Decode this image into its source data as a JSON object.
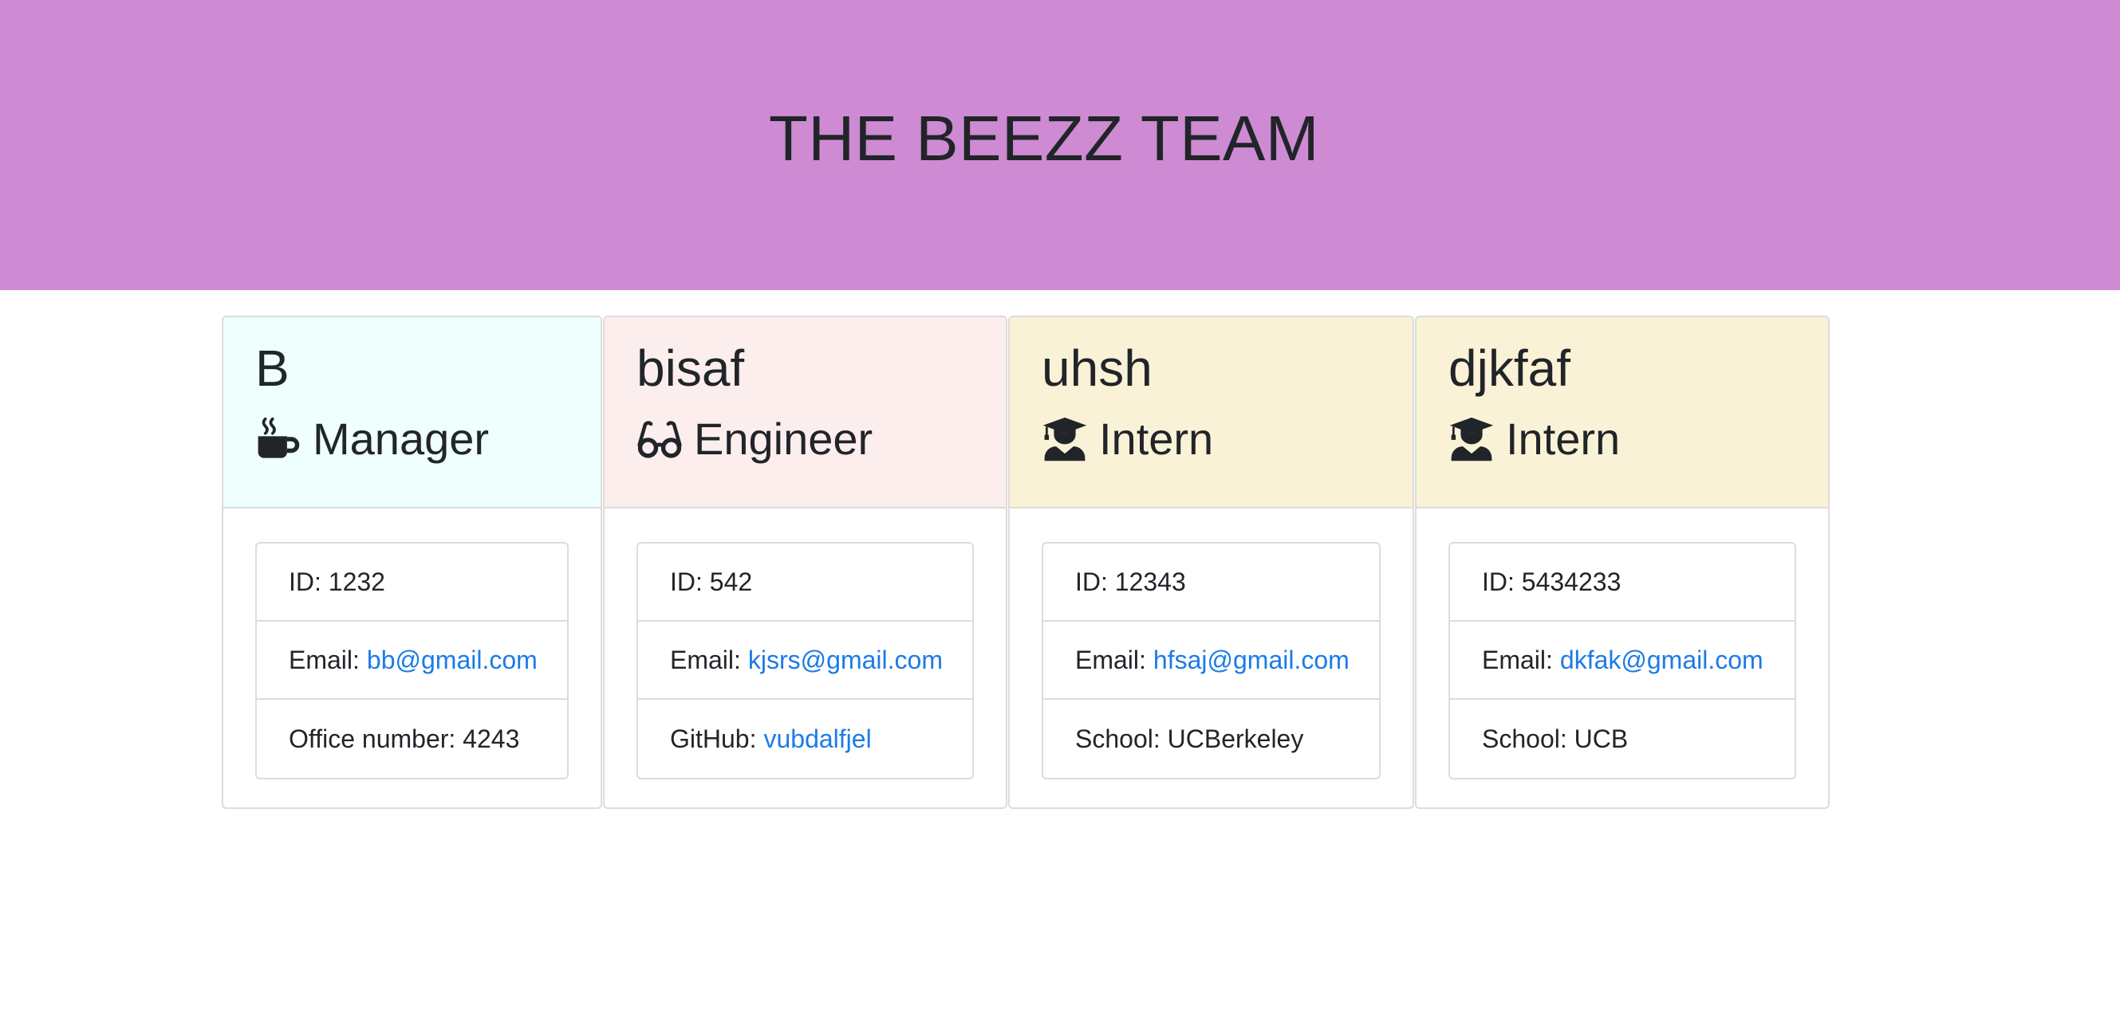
{
  "header": {
    "title": "THE BEEZZ TEAM",
    "background": "#ce8ad3"
  },
  "link_color": "#1b7be8",
  "cards": [
    {
      "name": "B",
      "role": "Manager",
      "role_icon": "coffee-mug-icon",
      "header_color": "#eefffe",
      "id_label": "ID:",
      "id_value": "1232",
      "email_label": "Email:",
      "email": "bb@gmail.com",
      "extra_label": "Office number:",
      "extra_value": "4243"
    },
    {
      "name": "bisaf",
      "role": "Engineer",
      "role_icon": "glasses-icon",
      "header_color": "#fdeeee",
      "id_label": "ID:",
      "id_value": "542",
      "email_label": "Email:",
      "email": "kjsrs@gmail.com",
      "extra_label": "GitHub:",
      "extra_value": "vubdalfjel"
    },
    {
      "name": "uhsh",
      "role": "Intern",
      "role_icon": "graduate-icon",
      "header_color": "#faf2d7",
      "id_label": "ID:",
      "id_value": "12343",
      "email_label": "Email:",
      "email": "hfsaj@gmail.com",
      "extra_label": "School:",
      "extra_value": "UCBerkeley"
    },
    {
      "name": "djkfaf",
      "role": "Intern",
      "role_icon": "graduate-icon",
      "header_color": "#faf2d7",
      "id_label": "ID:",
      "id_value": "5434233",
      "email_label": "Email:",
      "email": "dkfak@gmail.com",
      "extra_label": "School:",
      "extra_value": "UCB"
    }
  ]
}
